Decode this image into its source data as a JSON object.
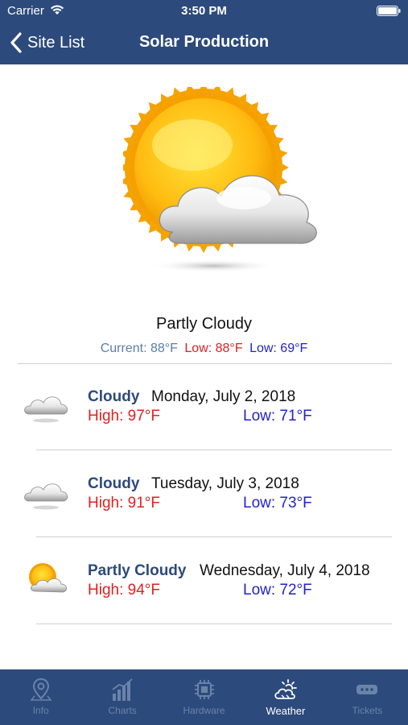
{
  "status_bar": {
    "carrier": "Carrier",
    "time": "3:50 PM"
  },
  "nav": {
    "back_label": "Site List",
    "title": "Solar Production"
  },
  "current": {
    "icon": "partly-cloudy-icon",
    "description": "Partly Cloudy",
    "current_temp": "Current: 88°F",
    "low_red": "Low: 88°F",
    "low_blue": "Low: 69°F"
  },
  "forecast": [
    {
      "icon": "cloudy-icon",
      "condition": "Cloudy",
      "date": "Monday, July 2, 2018",
      "high": "High: 97°F",
      "low": "Low: 71°F"
    },
    {
      "icon": "cloudy-icon",
      "condition": "Cloudy",
      "date": "Tuesday, July 3, 2018",
      "high": "High: 91°F",
      "low": "Low: 73°F"
    },
    {
      "icon": "partly-cloudy-icon",
      "condition": "Partly Cloudy",
      "date": "Wednesday, July 4, 2018",
      "high": "High: 94°F",
      "low": "Low: 72°F"
    }
  ],
  "tabs": [
    {
      "label": "Info",
      "icon": "map-pin-icon",
      "active": false
    },
    {
      "label": "Charts",
      "icon": "bar-chart-icon",
      "active": false
    },
    {
      "label": "Hardware",
      "icon": "chip-icon",
      "active": false
    },
    {
      "label": "Weather",
      "icon": "cloud-sun-icon",
      "active": true
    },
    {
      "label": "Tickets",
      "icon": "ticket-icon",
      "active": false
    }
  ],
  "colors": {
    "brand": "#2c4a7c",
    "high_temp": "#e02020",
    "low_temp": "#2323cc",
    "current_temp": "#5b7fa8",
    "tab_inactive": "#6a83a8",
    "tab_active": "#ffffff"
  }
}
